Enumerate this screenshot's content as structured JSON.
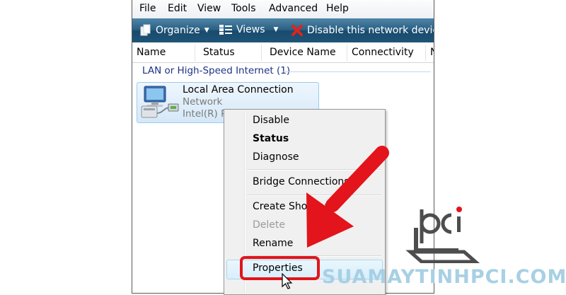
{
  "menubar": {
    "items": [
      "File",
      "Edit",
      "View",
      "Tools",
      "Advanced",
      "Help"
    ]
  },
  "toolbar": {
    "organize": "Organize",
    "views": "Views",
    "disable_device": "Disable this network device"
  },
  "columns": [
    "Name",
    "Status",
    "Device Name",
    "Connectivity",
    "N"
  ],
  "group": {
    "label": "LAN or High-Speed Internet (1)"
  },
  "connection": {
    "name": "Local Area Connection",
    "status": "Network",
    "device": "Intel(R) Pl"
  },
  "context_menu": {
    "disable": "Disable",
    "status": "Status",
    "diagnose": "Diagnose",
    "bridge": "Bridge Connections",
    "create_shortcut": "Create Shortcut",
    "delete": "Delete",
    "rename": "Rename",
    "properties": "Properties"
  },
  "watermark": "SUAMAYTINHPCI.COM",
  "colors": {
    "toolbar": "#2a5e82",
    "annotation_red": "#e3141b",
    "group_text": "#1e3287",
    "watermark": "#a8d0e4"
  }
}
